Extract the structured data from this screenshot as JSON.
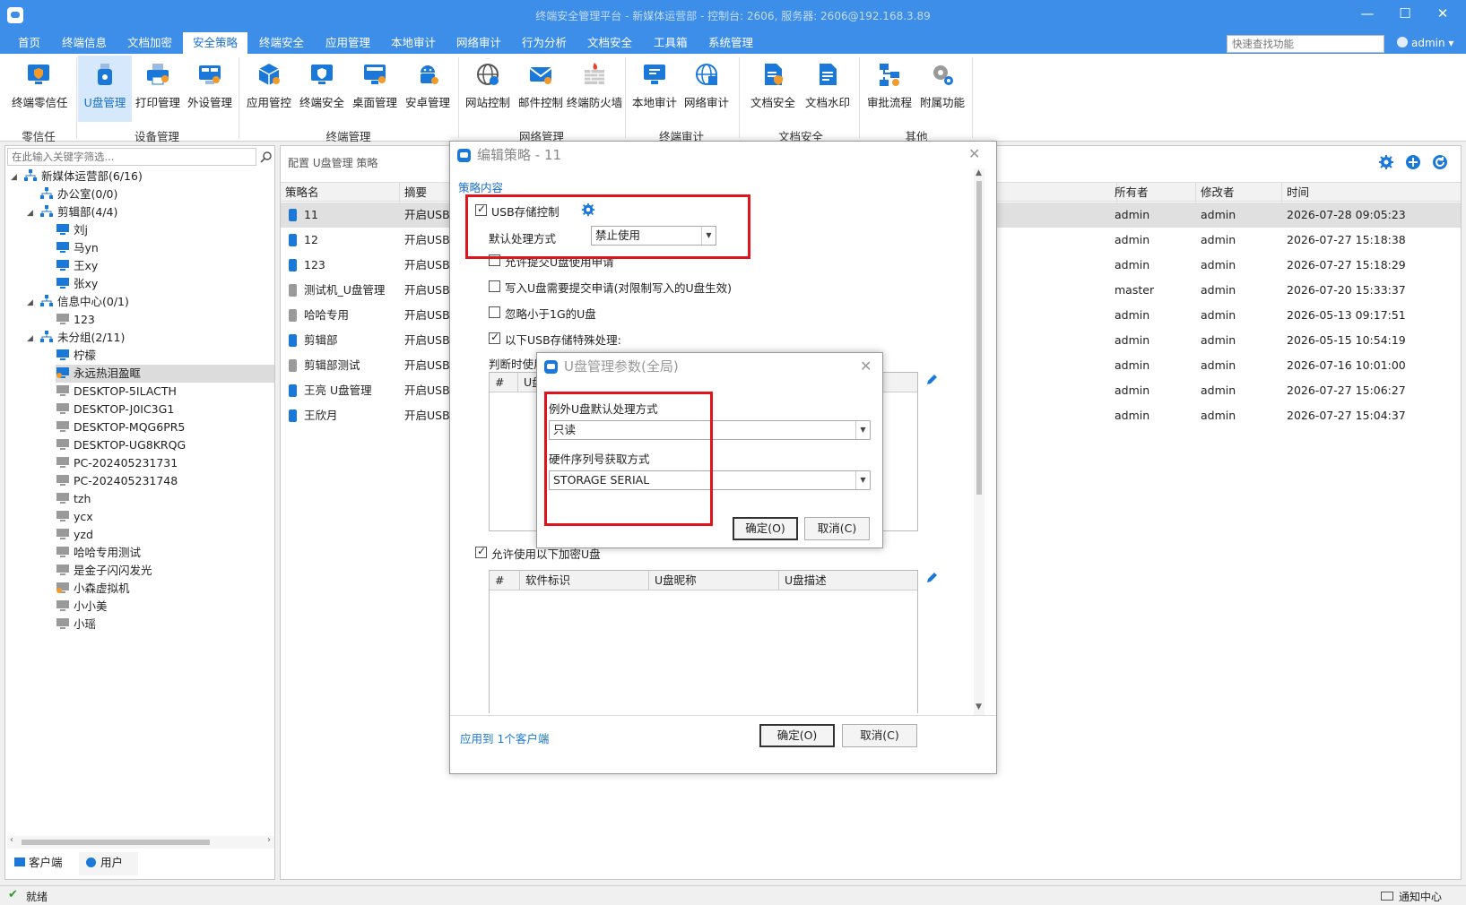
{
  "window": {
    "title": "终端安全管理平台 - 新媒体运营部 - 控制台: 2606, 服务器: 2606@192.168.3.89",
    "minimize": "—",
    "maximize": "☐",
    "close": "✕"
  },
  "menu": {
    "items": [
      "首页",
      "终端信息",
      "文档加密",
      "安全策略",
      "终端安全",
      "应用管理",
      "本地审计",
      "网络审计",
      "行为分析",
      "文档安全",
      "工具箱",
      "系统管理"
    ],
    "active_index": 3,
    "quick_search_placeholder": "快速查找功能",
    "user": "admin ▾"
  },
  "ribbon": {
    "buttons": [
      "终端零信任",
      "U盘管理",
      "打印管理",
      "外设管理",
      "应用管控",
      "终端安全",
      "桌面管理",
      "安卓管理",
      "网站控制",
      "邮件控制",
      "终端防火墙",
      "本地审计",
      "网络审计",
      "文档安全",
      "文档水印",
      "审批流程",
      "附属功能"
    ],
    "groups": [
      "零信任",
      "设备管理",
      "终端管理",
      "网络管理",
      "终端审计",
      "文档安全",
      "其他"
    ],
    "selected": "U盘管理"
  },
  "tree": {
    "search_placeholder": "在此输入关键字筛选...",
    "nodes": [
      "新媒体运营部(6/16)",
      "办公室(0/0)",
      "剪辑部(4/4)",
      "刘j",
      "马yn",
      "王xy",
      "张xy",
      "信息中心(0/1)",
      "123",
      "未分组(2/11)",
      "柠檬",
      "永远热泪盈眶",
      "DESKTOP-5ILACTH",
      "DESKTOP-J0IC3G1",
      "DESKTOP-MQG6PR5",
      "DESKTOP-UG8KRQG",
      "PC-202405231731",
      "PC-202405231748",
      "tzh",
      "ycx",
      "yzd",
      "哈哈专用测试",
      "是金子闪闪发光",
      "小森虚拟机",
      "小小美",
      "小瑶"
    ],
    "tabs": [
      "客户端",
      "用户"
    ]
  },
  "policy": {
    "breadcrumb": "配置 U盘管理 策略",
    "columns": [
      "策略名",
      "摘要",
      "所有者",
      "修改者",
      "时间"
    ],
    "rows": [
      {
        "name": "11",
        "summary": "开启USB",
        "owner": "admin",
        "modifier": "admin",
        "time": "2026-07-28 09:05:23"
      },
      {
        "name": "12",
        "summary": "开启USB",
        "owner": "admin",
        "modifier": "admin",
        "time": "2026-07-27 15:18:38"
      },
      {
        "name": "123",
        "summary": "开启USB",
        "owner": "admin",
        "modifier": "admin",
        "time": "2026-07-27 15:18:29"
      },
      {
        "name": "测试机_U盘管理",
        "summary": "开启USB",
        "owner": "master",
        "modifier": "admin",
        "time": "2026-07-20 15:33:37"
      },
      {
        "name": "哈哈专用",
        "summary": "开启USB",
        "owner": "admin",
        "modifier": "admin",
        "time": "2026-05-13 09:17:51"
      },
      {
        "name": "剪辑部",
        "summary": "开启USB",
        "owner": "admin",
        "modifier": "admin",
        "time": "2026-05-15 10:54:19"
      },
      {
        "name": "剪辑部测试",
        "summary": "开启USB",
        "owner": "admin",
        "modifier": "admin",
        "time": "2026-07-16 10:01:00"
      },
      {
        "name": "王亮 U盘管理",
        "summary": "开启USB",
        "owner": "admin",
        "modifier": "admin",
        "time": "2026-07-27 15:06:27"
      },
      {
        "name": "王欣月",
        "summary": "开启USB",
        "owner": "admin",
        "modifier": "admin",
        "time": "2026-07-27 15:04:37"
      }
    ]
  },
  "edit_dialog": {
    "title": "编辑策略 - 11",
    "section": "策略内容",
    "usb_control": "USB存储控制",
    "default_mode_label": "默认处理方式",
    "default_mode_value": "禁止使用",
    "allow_submit": "允许提交U盘使用申请",
    "write_apply": "写入U盘需要提交申请(对限制写入的U盘生效)",
    "ignore_small": "忽略小于1G的U盘",
    "special_usb": "以下USB存储特殊处理:",
    "judge_label": "判断时使用",
    "grid1_col1": "#",
    "grid1_col2": "U盘",
    "allow_encrypted": "允许使用以下加密U盘",
    "grid2_cols": [
      "#",
      "软件标识",
      "U盘昵称",
      "U盘描述"
    ],
    "apply_to": "应用到 1个客户端",
    "ok": "确定(O)",
    "cancel": "取消(C)"
  },
  "param_dialog": {
    "title": "U盘管理参数(全局)",
    "exception_label": "例外U盘默认处理方式",
    "exception_value": "只读",
    "serial_label": "硬件序列号获取方式",
    "serial_value": "STORAGE SERIAL",
    "ok": "确定(O)",
    "cancel": "取消(C)"
  },
  "status": {
    "left": "就绪",
    "right": "通知中心"
  },
  "colors": {
    "brand_blue": "#3d8ee8",
    "accent_blue": "#1a6fd0",
    "highlight_red": "#e0141c"
  }
}
